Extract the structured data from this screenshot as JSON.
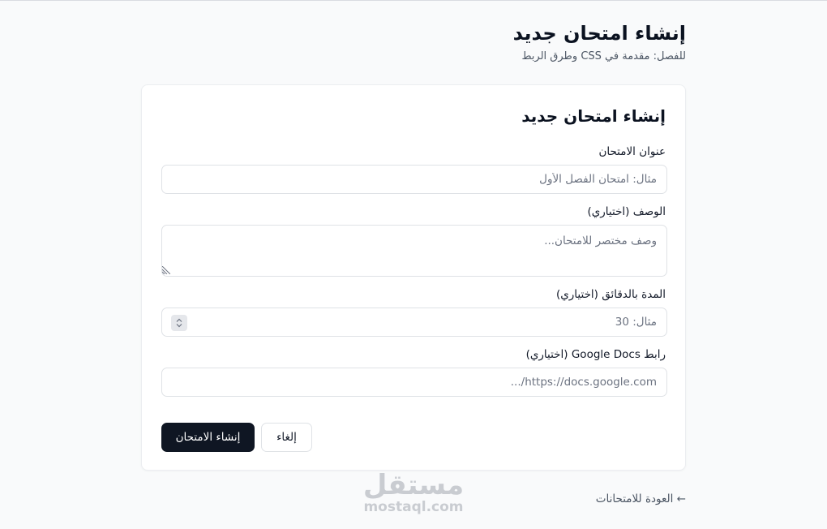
{
  "header": {
    "title": "إنشاء امتحان جديد",
    "subtitle": "للفصل: مقدمة في CSS وطرق الربط"
  },
  "form": {
    "title": "إنشاء امتحان جديد",
    "fields": {
      "exam_title": {
        "label": "عنوان الامتحان",
        "placeholder": "مثال: امتحان الفصل الأول",
        "value": ""
      },
      "description": {
        "label": "الوصف (اختياري)",
        "placeholder": "وصف مختصر للامتحان...",
        "value": ""
      },
      "duration": {
        "label": "المدة بالدقائق (اختياري)",
        "placeholder": "مثال: 30",
        "value": ""
      },
      "google_docs": {
        "label": "رابط Google Docs (اختياري)",
        "placeholder": "https://docs.google.com/...",
        "value": ""
      }
    },
    "buttons": {
      "submit": "إنشاء الامتحان",
      "cancel": "إلغاء"
    }
  },
  "footer": {
    "back_link": "← العودة للامتحانات"
  },
  "watermark": {
    "arabic": "مستقل",
    "latin": "mostaql.com"
  },
  "colors": {
    "background": "#f9fafb",
    "card": "#ffffff",
    "primary_button": "#0f1623",
    "border": "#dfe2e6",
    "muted_text": "#4b5563"
  }
}
